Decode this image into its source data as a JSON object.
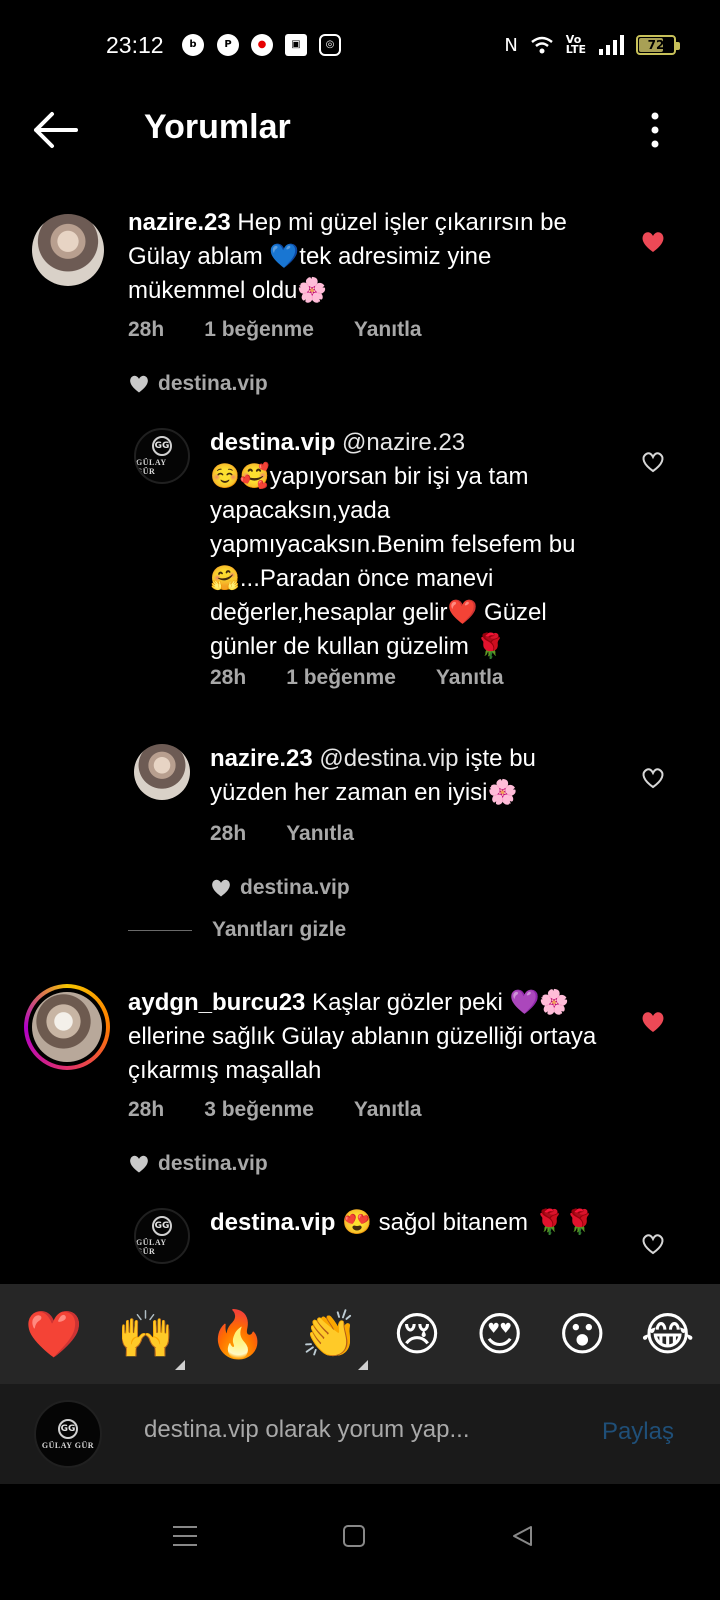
{
  "status_bar": {
    "time": "23:12",
    "apps": [
      "bip-icon",
      "pinterest-icon",
      "vodafone-icon",
      "cube-icon",
      "instagram-icon"
    ],
    "right_icons": [
      "nfc-icon",
      "wifi-icon",
      "volte-icon",
      "signal-icon"
    ],
    "battery_level": "72",
    "battery_fraction": 0.72
  },
  "header": {
    "title": "Yorumlar",
    "back_icon": "back-arrow-icon",
    "more_icon": "more-vertical-icon"
  },
  "comments": [
    {
      "user": "nazire.23",
      "text": " Hep mi güzel işler çıkarırsın be Gülay ablam 💙tek adresimiz yine mükemmel oldu🌸",
      "time": "28h",
      "likes": "1 beğenme",
      "reply": "Yanıtla",
      "liked": true,
      "liked_by": "destina.vip"
    },
    {
      "user": "destina.vip",
      "mention": " @nazire.23",
      "text": "☺️🥰yapıyorsan bir işi ya tam yapacaksın,yada yapmıyacaksın.Benim felsefem bu🤗...Paradan önce manevi değerler,hesaplar gelir❤️ Güzel günler de kullan güzelim 🌹",
      "time": "28h",
      "likes": "1 beğenme",
      "reply": "Yanıtla",
      "logo_short": "GG",
      "logo_name": "GÜLAY GÜR"
    },
    {
      "user": "nazire.23",
      "mention": " @destina.vip",
      "text": " işte bu yüzden her zaman en iyisi🌸",
      "time": "28h",
      "reply": "Yanıtla",
      "liked_by": "destina.vip"
    },
    {
      "user": "aydgn_burcu23",
      "text": " Kaşlar gözler peki 💜🌸 ellerine sağlık Gülay ablanın güzelliği ortaya çıkarmış maşallah",
      "time": "28h",
      "likes": "3 beğenme",
      "reply": "Yanıtla",
      "liked": true,
      "liked_by": "destina.vip"
    },
    {
      "user": "destina.vip",
      "text": " 😍 sağol bitanem 🌹🌹",
      "logo_short": "GG",
      "logo_name": "GÜLAY GÜR"
    }
  ],
  "hide_replies": "Yanıtları gizle",
  "emojis": [
    "❤️",
    "🙌",
    "🔥",
    "👏",
    "😢",
    "😍",
    "😮",
    "😂"
  ],
  "input": {
    "placeholder": "destina.vip olarak yorum yap...",
    "share_label": "Paylaş"
  },
  "navbar": [
    "menu-icon",
    "home-square-icon",
    "back-triangle-icon"
  ],
  "colors": {
    "background": "#000000",
    "heart_red": "#ed4956",
    "muted": "#a8a8a8",
    "share_blue": "#1f4f78"
  }
}
